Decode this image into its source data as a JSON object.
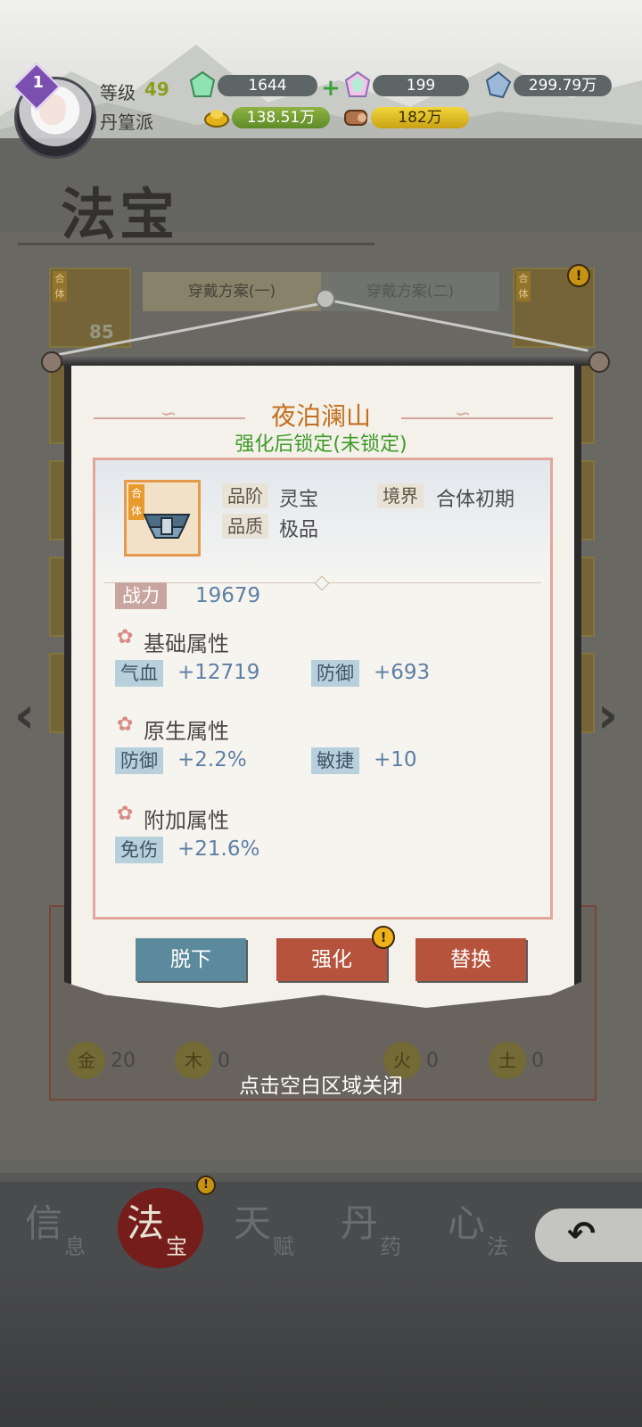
{
  "header": {
    "level_label": "等级",
    "level_value": "49",
    "rank_badge": "1",
    "sect_name": "丹篁派",
    "resources": {
      "jade": "1644",
      "rainbow_jade": "199",
      "crystal": "299.79万",
      "gold": "138.51万",
      "wood": "182万"
    }
  },
  "page": {
    "title": "法宝",
    "tabs": [
      "穿戴方案(一)",
      "穿戴方案(二)"
    ],
    "slot_tags": [
      "合体"
    ],
    "slot_count_text": "85",
    "elements": [
      {
        "name": "金",
        "count": "20"
      },
      {
        "name": "木",
        "count": "0"
      },
      {
        "name": "火",
        "count": "0"
      },
      {
        "name": "土",
        "count": "0"
      }
    ]
  },
  "bottom_nav": [
    {
      "big": "信",
      "small": "息"
    },
    {
      "big": "法",
      "small": "宝"
    },
    {
      "big": "天",
      "small": "赋"
    },
    {
      "big": "丹",
      "small": "药"
    },
    {
      "big": "心",
      "small": "法"
    }
  ],
  "modal": {
    "item_name": "夜泊澜山",
    "lock_status": "强化后锁定(未锁定)",
    "item_tag": "合体",
    "grade_label": "品阶",
    "grade_value": "灵宝",
    "realm_label": "境界",
    "realm_value": "合体初期",
    "quality_label": "品质",
    "quality_value": "极品",
    "power_label": "战力",
    "power_value": "19679",
    "sections": {
      "basic_title": "基础属性",
      "native_title": "原生属性",
      "extra_title": "附加属性"
    },
    "basic_attrs": [
      {
        "name": "气血",
        "value": "+12719"
      },
      {
        "name": "防御",
        "value": "+693"
      }
    ],
    "native_attrs": [
      {
        "name": "防御",
        "value": "+2.2%"
      },
      {
        "name": "敏捷",
        "value": "+10"
      }
    ],
    "extra_attrs": [
      {
        "name": "免伤",
        "value": "+21.6%"
      }
    ],
    "buttons": {
      "unequip": "脱下",
      "enhance": "强化",
      "replace": "替换"
    },
    "warn_mark": "!",
    "close_hint": "点击空白区域关闭"
  },
  "colors": {
    "item_name": "#c46e1f",
    "lock_status": "#3f9a2a",
    "button_blue": "#5c8a9d",
    "button_red": "#b5533c",
    "level_number": "#8a9f1e"
  }
}
